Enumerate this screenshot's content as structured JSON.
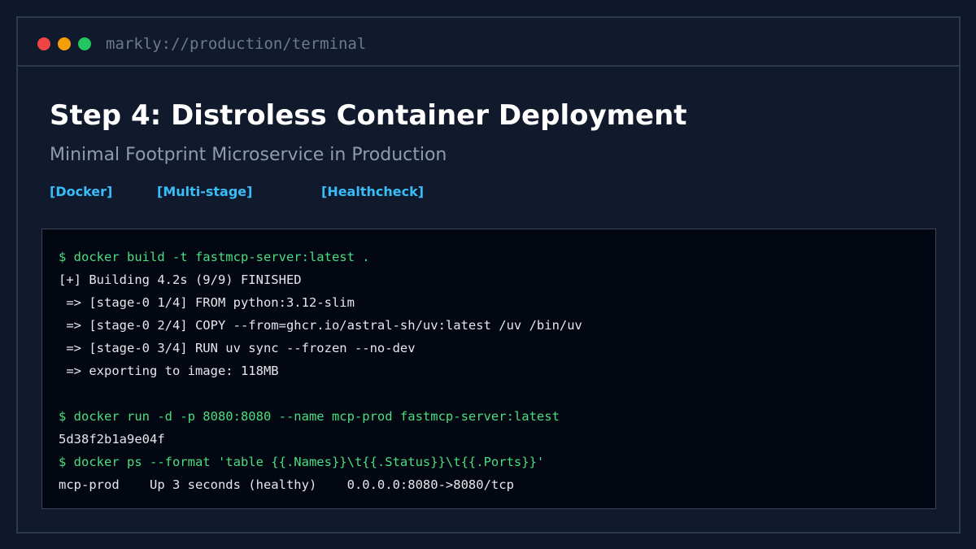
{
  "window": {
    "url": "markly://production/terminal",
    "traffic_lights": [
      {
        "name": "close",
        "color": "#ef4444"
      },
      {
        "name": "minimize",
        "color": "#f59e0b"
      },
      {
        "name": "maximize",
        "color": "#22c55e"
      }
    ]
  },
  "header": {
    "title": "Step 4: Distroless Container Deployment",
    "subtitle": "Minimal Footprint Microservice in Production"
  },
  "tags": [
    "[Docker]",
    "[Multi-stage]",
    "[Healthcheck]"
  ],
  "colors": {
    "background": "#0f172a",
    "panel": "#111a2c",
    "terminal_bg": "#030712",
    "command": "#4ade80",
    "output": "#e5e7eb",
    "tag": "#38bdf8"
  },
  "terminal": {
    "lines": [
      {
        "type": "command",
        "text": "$ docker build -t fastmcp-server:latest ."
      },
      {
        "type": "output",
        "text": "[+] Building 4.2s (9/9) FINISHED"
      },
      {
        "type": "output",
        "text": " => [stage-0 1/4] FROM python:3.12-slim"
      },
      {
        "type": "output",
        "text": " => [stage-0 2/4] COPY --from=ghcr.io/astral-sh/uv:latest /uv /bin/uv"
      },
      {
        "type": "output",
        "text": " => [stage-0 3/4] RUN uv sync --frozen --no-dev"
      },
      {
        "type": "output",
        "text": " => exporting to image: 118MB"
      },
      {
        "type": "blank",
        "text": ""
      },
      {
        "type": "command",
        "text": "$ docker run -d -p 8080:8080 --name mcp-prod fastmcp-server:latest"
      },
      {
        "type": "output",
        "text": "5d38f2b1a9e04f"
      },
      {
        "type": "command",
        "text": "$ docker ps --format 'table {{.Names}}\\t{{.Status}}\\t{{.Ports}}'"
      },
      {
        "type": "output",
        "text": "mcp-prod    Up 3 seconds (healthy)    0.0.0.0:8080->8080/tcp"
      }
    ]
  }
}
